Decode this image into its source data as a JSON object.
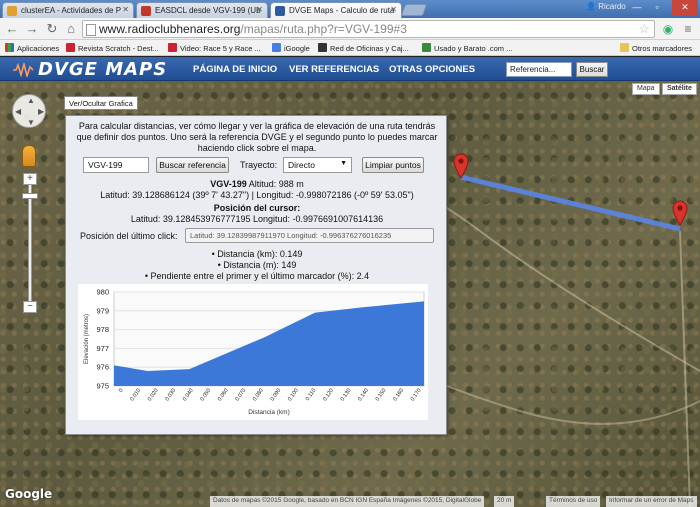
{
  "tabs": [
    {
      "label": "clusterEA - Actividades de P",
      "color": "#e0a030"
    },
    {
      "label": "EASDCL desde VGV-199 (Ub",
      "color": "#c0392b"
    },
    {
      "label": "DVGE Maps - Calculo de ruta",
      "color": "#2d5aa0"
    }
  ],
  "user": "Ricardo",
  "address": {
    "host": "www.radioclubhenares.org",
    "path": "/mapas/ruta.php?r=VGV-199#3"
  },
  "bookmarks": [
    "Aplicaciones",
    "Revista Scratch - Dest...",
    "Video: Race 5 y Race ...",
    "iGoogle",
    "Red de Oficinas y Caj...",
    "Usado y Barato .com ...",
    "Otros marcadores"
  ],
  "site": {
    "logo": "DVGE MAPS",
    "nav": [
      "PÁGINA DE INICIO",
      "VER REFERENCIAS",
      "OTRAS OPCIONES"
    ],
    "search_placeholder": "Referencia...",
    "search_button": "Buscar"
  },
  "map": {
    "types": [
      "Mapa",
      "Satélite"
    ],
    "toggle_label": "Ver/Ocultar Grafica",
    "google": "Google",
    "attribution": "Datos de mapas ©2015 Google, basado en BCN IGN España Imágenes ©2015, DigitalGlobe",
    "scale": "20 m",
    "terms": "Términos de uso",
    "report": "Informar de un error de Maps",
    "zoom_in": "+",
    "zoom_out": "−"
  },
  "panel": {
    "intro": "Para calcular distancias, ver cómo llegar y ver la gráfica de elevación de una ruta tendrás que definir dos puntos. Uno será la referencia DVGE y el segundo punto lo puedes marcar haciendo click sobre el mapa.",
    "ref_value": "VGV-199",
    "search_ref_button": "Buscar referencia",
    "trayecto_label": "Trayecto:",
    "trayecto_value": "Directo",
    "clear_button": "Limpiar puntos",
    "ref_name": "VGV-199",
    "altitude": "Altitud: 988 m",
    "ref_coords": "Latitud: 39.128686124 (39º 7' 43.27\") | Longitud: -0.998072186 (-0º 59' 53.05\")",
    "cursor_title": "Posición del cursor:",
    "cursor_coords": "Latitud: 39.128453976777195 Longitud: -0.9976691007614136",
    "last_click_label": "Posición del último click:",
    "last_click_value": "Latitud: 39.12839987911970 Longitud: -0.996376276016235",
    "stats": [
      "• Distancia (km): 0.149",
      "• Distancia (m): 149",
      "• Pendiente entre el primer y el último marcador (%): 2.4"
    ]
  },
  "chart_data": {
    "type": "area",
    "ylabel": "Elevación (metros)",
    "xlabel": "Distancia (km)",
    "ylim": [
      975,
      980
    ],
    "yticks": [
      975,
      976,
      977,
      978,
      979,
      980
    ],
    "xticks": [
      "0",
      "0.010",
      "0.020",
      "0.030",
      "0.040",
      "0.050",
      "0.060",
      "0.070",
      "0.080",
      "0.090",
      "0.100",
      "0.110",
      "0.120",
      "0.130",
      "0.140",
      "0.150",
      "0.160",
      "0.170"
    ],
    "x": [
      0,
      0.02,
      0.045,
      0.09,
      0.12,
      0.15,
      0.185
    ],
    "values": [
      976.1,
      975.8,
      975.9,
      977.6,
      978.9,
      979.2,
      979.5
    ],
    "color": "#3b78d8"
  }
}
